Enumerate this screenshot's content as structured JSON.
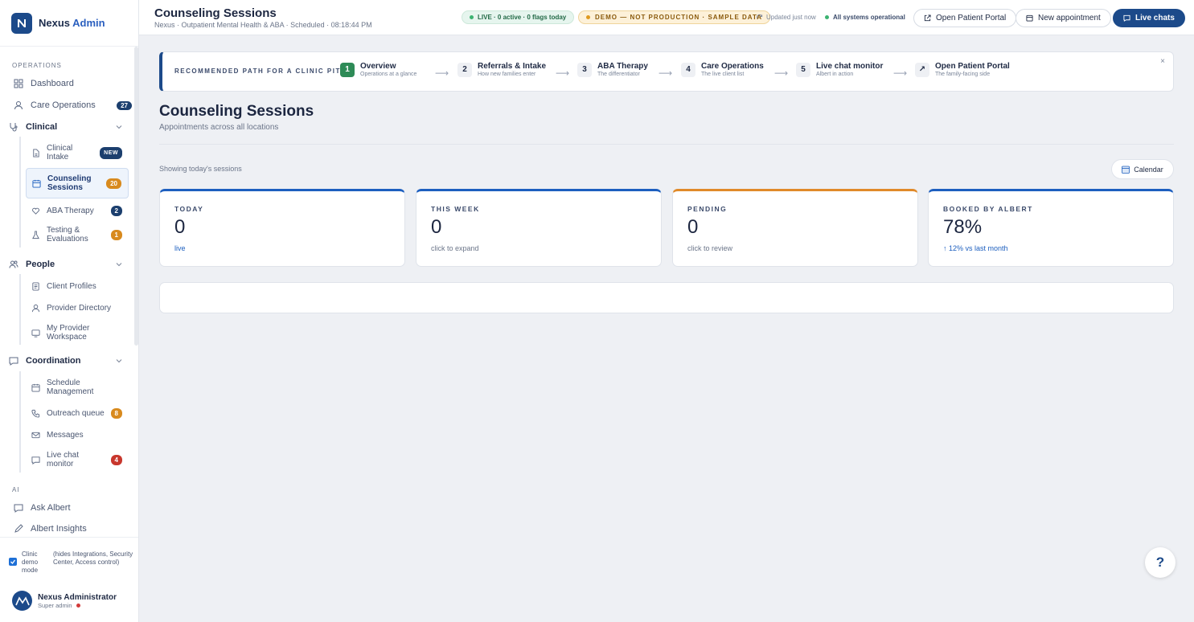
{
  "brand": {
    "name": "Nexus",
    "suffix": "Admin"
  },
  "sidebar": {
    "operations_label": "OPERATIONS",
    "dashboard": "Dashboard",
    "care_operations": {
      "label": "Care Operations",
      "badge": "27"
    },
    "clinical": {
      "label": "Clinical",
      "items": [
        {
          "label": "Clinical Intake",
          "badge": "NEW"
        },
        {
          "label": "Counseling Sessions",
          "badge": "20"
        },
        {
          "label": "ABA Therapy",
          "badge": "2"
        },
        {
          "label": "Testing & Evaluations",
          "badge": "1"
        }
      ]
    },
    "people": {
      "label": "People",
      "items": [
        {
          "label": "Client Profiles"
        },
        {
          "label": "Provider Directory"
        },
        {
          "label": "My Provider Workspace"
        }
      ]
    },
    "coordination": {
      "label": "Coordination",
      "items": [
        {
          "label": "Schedule Management"
        },
        {
          "label": "Outreach queue",
          "badge": "8"
        },
        {
          "label": "Messages"
        },
        {
          "label": "Live chat monitor",
          "badge": "4"
        }
      ]
    },
    "ai_label": "AI",
    "ask_albert": "Ask Albert",
    "albert_insights": "Albert Insights"
  },
  "footer": {
    "demo_mode_label": "Clinic demo mode",
    "demo_mode_hint": "(hides Integrations, Security Center, Access control)",
    "user_name": "Nexus Administrator",
    "user_role": "Super admin"
  },
  "header": {
    "title": "Counseling Sessions",
    "subtitle": "Nexus · Outpatient Mental Health & ABA · Scheduled · 08:18:44 PM",
    "live_pill": "LIVE · 0 active · 0 flags today",
    "demo_pill": "DEMO — NOT PRODUCTION · SAMPLE DATA",
    "updated": "Updated just now",
    "system_status": "All systems operational",
    "open_portal": "Open Patient Portal",
    "new_appointment": "New appointment",
    "live_chats": "Live chats"
  },
  "path": {
    "label": "RECOMMENDED PATH FOR A CLINIC PITCH",
    "steps": [
      {
        "num": "1",
        "title": "Overview",
        "desc": "Operations at a glance"
      },
      {
        "num": "2",
        "title": "Referrals & Intake",
        "desc": "How new families enter"
      },
      {
        "num": "3",
        "title": "ABA Therapy",
        "desc": "The differentiator"
      },
      {
        "num": "4",
        "title": "Care Operations",
        "desc": "The live client list"
      },
      {
        "num": "5",
        "title": "Live chat monitor",
        "desc": "Albert in action"
      },
      {
        "num": "↗",
        "title": "Open Patient Portal",
        "desc": "The family-facing side"
      }
    ],
    "arrow": "⟶",
    "close": "×"
  },
  "page": {
    "title": "Counseling Sessions",
    "subtitle": "Appointments across all locations",
    "showing": "Showing today's sessions",
    "calendar": "Calendar"
  },
  "cards": [
    {
      "label": "TODAY",
      "value": "0",
      "foot": "live"
    },
    {
      "label": "THIS WEEK",
      "value": "0",
      "foot": "click to expand"
    },
    {
      "label": "PENDING",
      "value": "0",
      "foot": "click to review"
    },
    {
      "label": "BOOKED BY ALBERT",
      "value": "78%",
      "foot": "↑ 12% vs last month"
    }
  ],
  "help": "?",
  "colors": {
    "brand": "#1c4a8a",
    "accent_blue": "#1d5fbf",
    "pending_orange": "#e08a2a",
    "live_green": "#3cb371"
  }
}
